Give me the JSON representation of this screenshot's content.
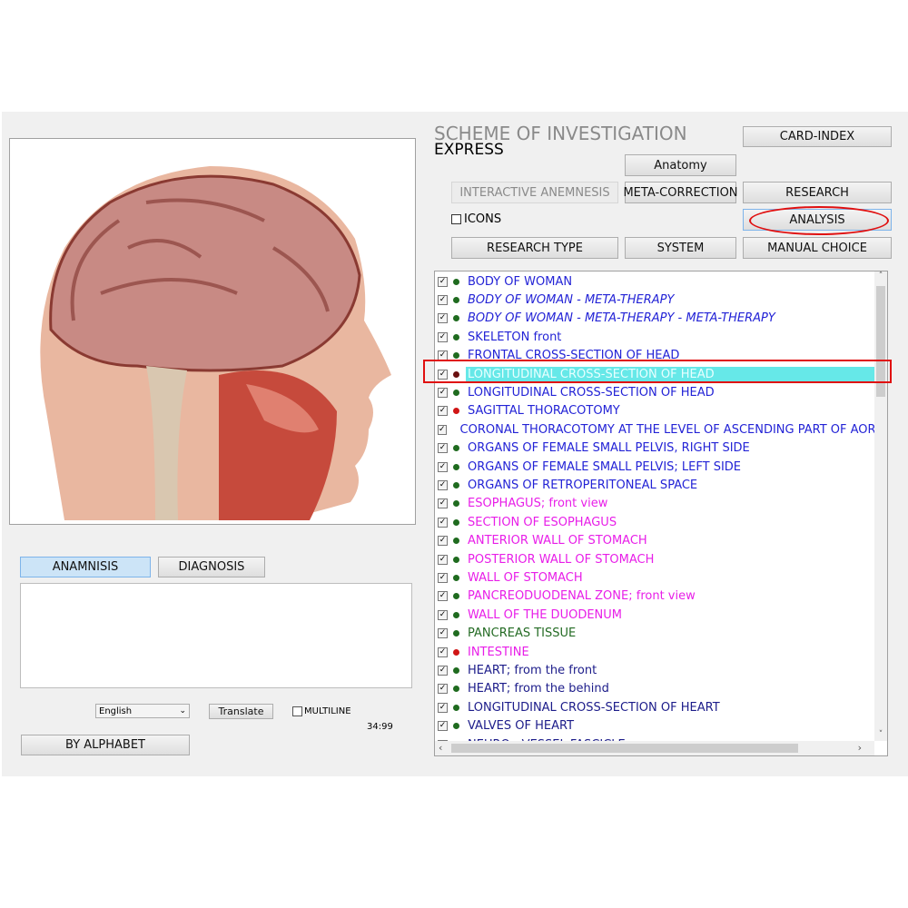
{
  "header": {
    "title": "SCHEME OF INVESTIGATION",
    "subtitle": "EXPRESS"
  },
  "buttons": {
    "card_index": "CARD-INDEX",
    "anatomy": "Anatomy",
    "interactive_anemnesis": "INTERACTIVE ANEMNESIS",
    "meta_correction": "META-CORRECTION",
    "research": "RESEARCH",
    "analysis": "ANALYSIS",
    "research_type": "RESEARCH TYPE",
    "system": "SYSTEM",
    "manual_choice": "MANUAL CHOICE"
  },
  "icons_checkbox": {
    "label": "ICONS",
    "checked": false
  },
  "tabs": {
    "anamnisis": "ANAMNISIS",
    "diagnosis": "DIAGNOSIS",
    "active": "ANAMNISIS"
  },
  "notes": {
    "value": ""
  },
  "language": {
    "selected": "English"
  },
  "translate_label": "Translate",
  "multiline": {
    "label": "MULTILINE",
    "checked": false
  },
  "counter": "34:99",
  "by_alphabet_label": "BY ALPHABET",
  "annotation_color": "#e01010",
  "colors": {
    "blue": "#2323d6",
    "italic_blue": "#2323d6",
    "magenta": "#e81ee8",
    "green": "#246b24",
    "navy": "#1c1c8a",
    "dot_green": "#1f6b1f",
    "dot_red": "#d01515",
    "dot_dark": "#6a1010",
    "selection": "#66e8e8"
  },
  "list": [
    {
      "label": "BODY OF WOMAN",
      "color": "blue",
      "dot": "dot_green"
    },
    {
      "label": "BODY OF WOMAN - META-THERAPY",
      "color": "blue",
      "dot": "dot_green",
      "italic": true
    },
    {
      "label": "BODY OF WOMAN - META-THERAPY - META-THERAPY",
      "color": "blue",
      "dot": "dot_green",
      "italic": true
    },
    {
      "label": "SKELETON front",
      "color": "blue",
      "dot": "dot_green"
    },
    {
      "label": "FRONTAL CROSS-SECTION OF HEAD",
      "color": "blue",
      "dot": "dot_green"
    },
    {
      "label": "LONGITUDINAL CROSS-SECTION OF HEAD",
      "color": "blue",
      "dot": "dot_dark",
      "selected": true
    },
    {
      "label": "LONGITUDINAL CROSS-SECTION OF HEAD",
      "color": "blue",
      "dot": "dot_green"
    },
    {
      "label": "SAGITTAL THORACOTOMY",
      "color": "blue",
      "dot": "dot_red"
    },
    {
      "label": "CORONAL THORACOTOMY AT THE LEVEL OF ASCENDING PART OF AORTA",
      "color": "blue",
      "dot": "dot_green"
    },
    {
      "label": "ORGANS OF FEMALE SMALL PELVIS, RIGHT SIDE",
      "color": "blue",
      "dot": "dot_green"
    },
    {
      "label": "ORGANS OF FEMALE SMALL PELVIS; LEFT SIDE",
      "color": "blue",
      "dot": "dot_green"
    },
    {
      "label": "ORGANS OF RETROPERITONEAL SPACE",
      "color": "blue",
      "dot": "dot_green"
    },
    {
      "label": "ESOPHAGUS; front view",
      "color": "magenta",
      "dot": "dot_green"
    },
    {
      "label": "SECTION OF ESOPHAGUS",
      "color": "magenta",
      "dot": "dot_green"
    },
    {
      "label": "ANTERIOR  WALL  OF  STOMACH",
      "color": "magenta",
      "dot": "dot_green"
    },
    {
      "label": "POSTERIOR WALL OF STOMACH",
      "color": "magenta",
      "dot": "dot_green"
    },
    {
      "label": "WALL OF STOMACH",
      "color": "magenta",
      "dot": "dot_green"
    },
    {
      "label": "PANCREODUODENAL ZONE; front view",
      "color": "magenta",
      "dot": "dot_green"
    },
    {
      "label": "WALL  OF  THE  DUODENUM",
      "color": "magenta",
      "dot": "dot_green"
    },
    {
      "label": "PANCREAS  TISSUE",
      "color": "green",
      "dot": "dot_green"
    },
    {
      "label": "INTESTINE",
      "color": "magenta",
      "dot": "dot_red"
    },
    {
      "label": "HEART;  from the front",
      "color": "navy",
      "dot": "dot_green"
    },
    {
      "label": "HEART;  from the behind",
      "color": "navy",
      "dot": "dot_green"
    },
    {
      "label": "LONGITUDINAL CROSS-SECTION OF HEART",
      "color": "navy",
      "dot": "dot_green"
    },
    {
      "label": "VALVES OF HEART",
      "color": "navy",
      "dot": "dot_green"
    },
    {
      "label": "NEURO - VESSEL  FASCICLE",
      "color": "navy",
      "dot": "dot_green"
    }
  ]
}
